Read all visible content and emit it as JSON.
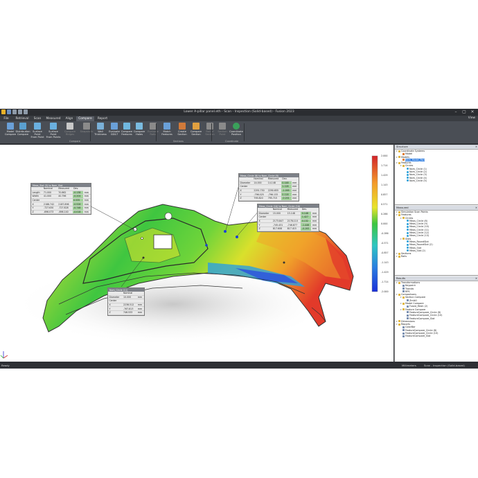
{
  "titlebar": {
    "title": "Lower A-pillar panel.eth - Scan - Inspection (Solid-based) - Fusion 2023"
  },
  "menu": {
    "tabs": [
      "File",
      "Retrieval",
      "Scan",
      "Measured",
      "Align",
      "Compare",
      "Report"
    ],
    "active": "Compare",
    "view": "View"
  },
  "ribbon": {
    "buttons": [
      "Model\nCompare",
      "Distribution\nCompare",
      "Surface Point\nFrom Point",
      "Surface Point\nFrom Points",
      "Compare\nRidges",
      "Snapshots",
      "Wall\nThickness",
      "Evaluate\nGD&T",
      "Compare\nFeatures",
      "Compare\nHoles",
      "Evaluate\nRatio",
      "Match\nFeatures",
      "Create\nSection",
      "Compare\nSection",
      "Rail of\nSection",
      "Section\nPoint",
      "Coordinate\nPosition"
    ],
    "groups": [
      "Compare",
      "Sections",
      "Coordinate"
    ]
  },
  "callouts": {
    "slot": {
      "title": "Meas_Slot (3) to Nom_Slot",
      "header": [
        "",
        "Nominal",
        "Measured",
        "Dev."
      ],
      "rows": [
        [
          "Length",
          "71.000",
          "70.862",
          "-0.138",
          "mm"
        ],
        [
          "Width",
          "41.000",
          "40.796",
          "-0.204",
          "mm"
        ],
        [
          "Center",
          "",
          "",
          "0.535",
          "mm"
        ],
        [
          "X",
          "2188.742",
          "2187.896",
          "-0.526",
          "mm"
        ],
        [
          "Y",
          "-727.630",
          "-727.828",
          "-0.748",
          "mm"
        ],
        [
          "Z",
          "-696.073",
          "-696.140",
          "-0.018",
          "mm"
        ]
      ]
    },
    "circle8": {
      "title": "Meas_Circle (8) to Nom_Circle (8)",
      "header": [
        "",
        "Nominal",
        "Measured",
        "Dev."
      ],
      "rows": [
        [
          "Diameter",
          "14.000",
          "14.148",
          "0.148",
          "mm"
        ],
        [
          "Center",
          "",
          "",
          "1.128",
          "mm"
        ],
        [
          "X",
          "2291.750",
          "2290.655",
          "-1.095",
          "mm"
        ],
        [
          "Y",
          "-796.025",
          "-796.133",
          "0.118",
          "mm"
        ],
        [
          "Z",
          "795.820",
          "795.715",
          "-0.201",
          "mm"
        ]
      ]
    },
    "circle10": {
      "title": "Meas_Circle (10) to Nom_Circle (10)",
      "header": [
        "",
        "Nominal",
        "Measured",
        "Dev."
      ],
      "rows": [
        [
          "Diameter",
          "15.000",
          "15.148",
          "0.148",
          "mm"
        ],
        [
          "Center",
          "",
          "",
          "1.427",
          "mm"
        ],
        [
          "X",
          "2173.847",
          "2178.110",
          "0.132",
          "mm"
        ],
        [
          "Y",
          "-745.431",
          "-746.877",
          "-1.446",
          "mm"
        ],
        [
          "Z",
          "817.608",
          "817.415",
          "-0.193",
          "mm"
        ]
      ]
    },
    "hole": {
      "title": "Nom_Circle (11)",
      "header": [
        "",
        "Nominal",
        ""
      ],
      "rows": [
        [
          "Diameter",
          "10.000",
          "mm"
        ],
        [
          "Center",
          "",
          ""
        ],
        [
          "X",
          "2236.512",
          "mm"
        ],
        [
          "Y",
          "-767.813",
          "mm"
        ],
        [
          "Z",
          "746.533",
          "mm"
        ]
      ]
    }
  },
  "scale": {
    "labels": [
      "2.000",
      "1.714",
      "1.429",
      "1.143",
      "0.857",
      "0.571",
      "0.286",
      "0.000",
      "-0.286",
      "-0.571",
      "-0.857",
      "-1.143",
      "-1.429",
      "-1.714",
      "-2.000"
    ]
  },
  "panels": {
    "p1": {
      "title": "Structure",
      "items": [
        [
          "Coordinate Systems",
          0,
          "folder",
          true
        ],
        [
          "Model",
          1,
          "orange",
          false
        ],
        [
          "Models",
          0,
          "folder",
          true
        ],
        [
          "Nom_Model_Part",
          1,
          "orange",
          false,
          true
        ],
        [
          "Features",
          0,
          "folder",
          true
        ],
        [
          "Circles",
          1,
          "folder",
          true
        ],
        [
          "Nom_Circle (1)",
          2,
          "circ",
          false
        ],
        [
          "Nom_Circle (2)",
          2,
          "circ",
          false
        ],
        [
          "Nom_Circle (3)",
          2,
          "circ",
          false
        ],
        [
          "Nom_Circle (4)",
          2,
          "circ",
          false
        ],
        [
          "Nom_Circle (5)",
          2,
          "circ",
          false
        ]
      ]
    },
    "p2": {
      "title": "Measured",
      "items": [
        [
          "Simulation Scan Points",
          0,
          "folder",
          true
        ],
        [
          "Features",
          0,
          "folder",
          true
        ],
        [
          "Circles",
          1,
          "folder",
          true
        ],
        [
          "Meas_Circle (8)",
          2,
          "circ",
          false
        ],
        [
          "Meas_Circle (9)",
          2,
          "circ",
          false
        ],
        [
          "Meas_Circle (10)",
          2,
          "circ",
          false
        ],
        [
          "Meas_Circle (11)",
          2,
          "circ",
          false
        ],
        [
          "Meas_Circle (12)",
          2,
          "circ",
          false
        ],
        [
          "Meas_Circle (13)",
          2,
          "circ",
          false
        ],
        [
          "Slots",
          1,
          "folder",
          true
        ],
        [
          "Meas_RoundSlot",
          2,
          "circ",
          false
        ],
        [
          "Meas_RoundSlot (2)",
          2,
          "circ",
          false
        ],
        [
          "Meas_Slot",
          2,
          "circ",
          false
        ],
        [
          "Meas_Slot (2)",
          2,
          "circ",
          false
        ],
        [
          "Sections",
          0,
          "folder",
          true
        ],
        [
          "Rails",
          0,
          "folder",
          true
        ]
      ]
    },
    "p3": {
      "title": "Results",
      "items": [
        [
          "Transformations",
          0,
          "folder",
          true
        ],
        [
          "Keypoint",
          1,
          "doc",
          false
        ],
        [
          "Transfo",
          1,
          "doc",
          false
        ],
        [
          "RPS",
          1,
          "doc",
          false
        ],
        [
          "Comparisons",
          0,
          "folder",
          true
        ],
        [
          "Section Compare",
          1,
          "folder",
          true
        ],
        [
          "Zmlk0",
          2,
          "doc",
          false
        ],
        [
          "Model Compare",
          1,
          "folder",
          true
        ],
        [
          "Fused_Mesh (2)",
          2,
          "doc",
          false
        ],
        [
          "Feature Compare",
          1,
          "folder",
          true
        ],
        [
          "FeatureCompare_Circle (8)",
          2,
          "doc",
          false
        ],
        [
          "FeatureCompare_Circle (10)",
          2,
          "doc",
          false
        ],
        [
          "FeatureCompare_Slot",
          2,
          "doc",
          false
        ],
        [
          "Dimensions",
          0,
          "folder",
          true
        ],
        [
          "Reports",
          0,
          "folder",
          true
        ],
        [
          "ColorBar",
          1,
          "doc",
          false
        ],
        [
          "FeatureCompare_Circle (8)",
          1,
          "doc",
          false
        ],
        [
          "FeatureCompare_Circle (10)",
          1,
          "doc",
          false
        ],
        [
          "FeatureCompare_Slot",
          1,
          "doc",
          false
        ]
      ]
    }
  },
  "status": {
    "left": "Ready",
    "units": "Millimeters",
    "mode": "Scan - Inspection (Solid-based)"
  },
  "colors": {
    "accent": "#2f7de0",
    "tab_active": "#5a5e66"
  }
}
